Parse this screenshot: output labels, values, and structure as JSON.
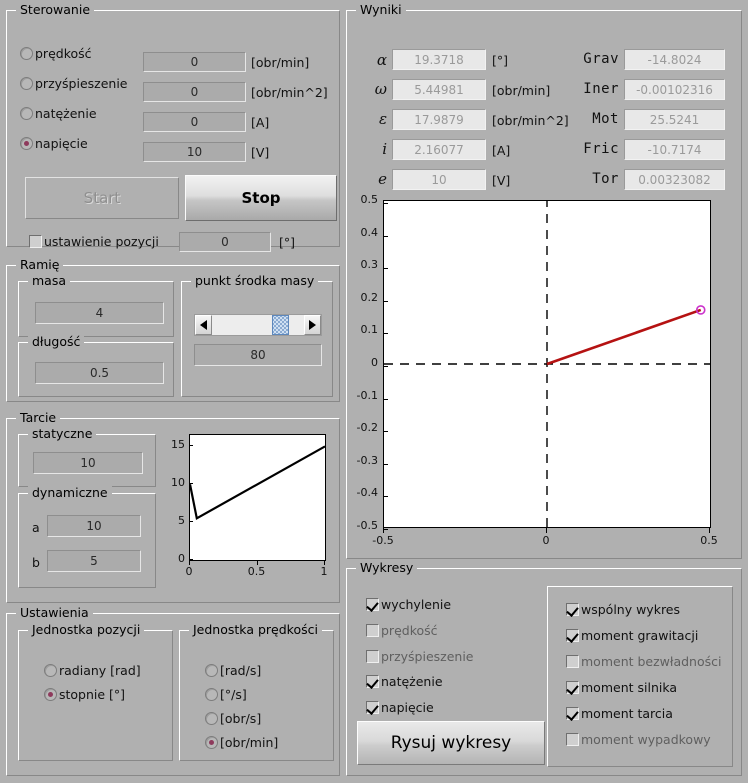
{
  "panels": {
    "sterowanie": "Sterowanie",
    "ramie": "Ramię",
    "masa": "masa",
    "dlugosc": "długość",
    "punkt_srodka_masy": "punkt środka masy",
    "tarcie": "Tarcie",
    "statyczne": "statyczne",
    "dynamiczne": "dynamiczne",
    "ustawienia": "Ustawienia",
    "jednostka_pozycji": "Jednostka pozycji",
    "jednostka_predkosci": "Jednostka prędkości",
    "wyniki": "Wyniki",
    "wykresy": "Wykresy"
  },
  "control": {
    "modes": [
      {
        "label": "prędkość",
        "value": "0",
        "unit": "[obr/min]",
        "selected": false
      },
      {
        "label": "przyśpieszenie",
        "value": "0",
        "unit": "[obr/min^2]",
        "selected": false
      },
      {
        "label": "natężenie",
        "value": "0",
        "unit": "[A]",
        "selected": false
      },
      {
        "label": "napięcie",
        "value": "10",
        "unit": "[V]",
        "selected": true
      }
    ],
    "start_label": "Start",
    "start_enabled": false,
    "stop_label": "Stop",
    "stop_enabled": true,
    "position_set": {
      "label": "ustawienie pozycji",
      "checked": false,
      "value": "0",
      "unit": "[°]"
    }
  },
  "arm": {
    "mass_value": "4",
    "length_value": "0.5",
    "com_value": "80",
    "com_slider_percent": 80
  },
  "friction": {
    "static_value": "10",
    "dynamic_a_label": "a",
    "dynamic_a_value": "10",
    "dynamic_b_label": "b",
    "dynamic_b_value": "5"
  },
  "settings": {
    "position_units": [
      {
        "label": "radiany [rad]",
        "selected": false
      },
      {
        "label": "stopnie [°]",
        "selected": true
      }
    ],
    "speed_units": [
      {
        "label": "[rad/s]",
        "selected": false
      },
      {
        "label": "[°/s]",
        "selected": false
      },
      {
        "label": "[obr/s]",
        "selected": false
      },
      {
        "label": "[obr/min]",
        "selected": true
      }
    ]
  },
  "results": {
    "left": [
      {
        "symbol": "α",
        "value": "19.3718",
        "unit": "[°]"
      },
      {
        "symbol": "ω",
        "value": "5.44981",
        "unit": "[obr/min]"
      },
      {
        "symbol": "ε",
        "value": "17.9879",
        "unit": "[obr/min^2]"
      },
      {
        "symbol": "i",
        "value": "2.16077",
        "unit": "[A]"
      },
      {
        "symbol": "e",
        "value": "10",
        "unit": "[V]"
      }
    ],
    "right": [
      {
        "symbol": "Grav",
        "value": "-14.8024"
      },
      {
        "symbol": "Iner",
        "value": "-0.00102316"
      },
      {
        "symbol": "Mot",
        "value": "25.5241"
      },
      {
        "symbol": "Fric",
        "value": "-10.7174"
      },
      {
        "symbol": "Tor",
        "value": "0.00323082"
      }
    ]
  },
  "charts_panel": {
    "left_checks": [
      {
        "label": "wychylenie",
        "checked": true,
        "dim": false
      },
      {
        "label": "prędkość",
        "checked": false,
        "dim": true
      },
      {
        "label": "przyśpieszenie",
        "checked": false,
        "dim": true
      },
      {
        "label": "natężenie",
        "checked": true,
        "dim": false
      },
      {
        "label": "napięcie",
        "checked": true,
        "dim": false
      }
    ],
    "right_checks": [
      {
        "label": "wspólny wykres",
        "checked": true,
        "dim": false
      },
      {
        "label": "moment grawitacji",
        "checked": true,
        "dim": false
      },
      {
        "label": "moment bezwładności",
        "checked": false,
        "dim": true
      },
      {
        "label": "moment silnika",
        "checked": true,
        "dim": false
      },
      {
        "label": "moment tarcia",
        "checked": true,
        "dim": false
      },
      {
        "label": "moment wypadkowy",
        "checked": false,
        "dim": true
      }
    ],
    "draw_button": "Rysuj wykresy"
  },
  "colors": {
    "background": "#b0b0b0",
    "arm_line": "#b51212",
    "arm_marker": "#cc33cc",
    "radio_dot": "#8e3a5c",
    "slider_thumb": "#cfe0f2"
  },
  "chart_data": [
    {
      "type": "line",
      "name": "arm-position-plot",
      "title": "",
      "xlabel": "",
      "ylabel": "",
      "xlim": [
        -0.5,
        0.5
      ],
      "ylim": [
        -0.5,
        0.5
      ],
      "xticks": [
        -0.5,
        0,
        0.5
      ],
      "yticks": [
        0.5,
        0.4,
        0.3,
        0.2,
        0.1,
        0,
        -0.1,
        -0.2,
        -0.3,
        -0.4,
        -0.5
      ],
      "xticklabels": [
        "-0.5",
        "0",
        "0.5"
      ],
      "yticklabels": [
        "0.5",
        "0.4",
        "0.3",
        "0.2",
        "0.1",
        "0",
        "-0.1",
        "-0.2",
        "-0.3",
        "-0.4",
        "-0.5"
      ],
      "grid": false,
      "legend": null,
      "series": [
        {
          "name": "arm",
          "style": "solid",
          "color": "#b51212",
          "x": [
            0,
            0.4716
          ],
          "y": [
            0,
            0.1658
          ],
          "marker_at_end": true,
          "marker_color": "#cc33cc"
        },
        {
          "name": "x-axis-reference",
          "style": "dashed",
          "color": "#000000",
          "x": [
            -0.5,
            0.5
          ],
          "y": [
            0,
            0
          ]
        },
        {
          "name": "y-axis-reference",
          "style": "dashed",
          "color": "#000000",
          "x": [
            0,
            0
          ],
          "y": [
            -0.5,
            0.5
          ]
        }
      ],
      "annotations": [
        "arm angle 19.3718 deg, length 0.5"
      ]
    },
    {
      "type": "line",
      "name": "friction-plot",
      "title": "",
      "xlabel": "",
      "ylabel": "",
      "xlim": [
        0,
        1
      ],
      "ylim": [
        0,
        16.5
      ],
      "xticks": [
        0,
        0.5,
        1
      ],
      "yticks": [
        0,
        5,
        10,
        15
      ],
      "xticklabels": [
        "0",
        "0.5",
        "1"
      ],
      "yticklabels": [
        "0",
        "5",
        "10",
        "15"
      ],
      "grid": false,
      "legend": null,
      "series": [
        {
          "name": "friction-torque",
          "style": "solid",
          "color": "#000000",
          "x": [
            0,
            0.05,
            1
          ],
          "y": [
            10,
            5.5,
            15
          ]
        }
      ]
    }
  ]
}
